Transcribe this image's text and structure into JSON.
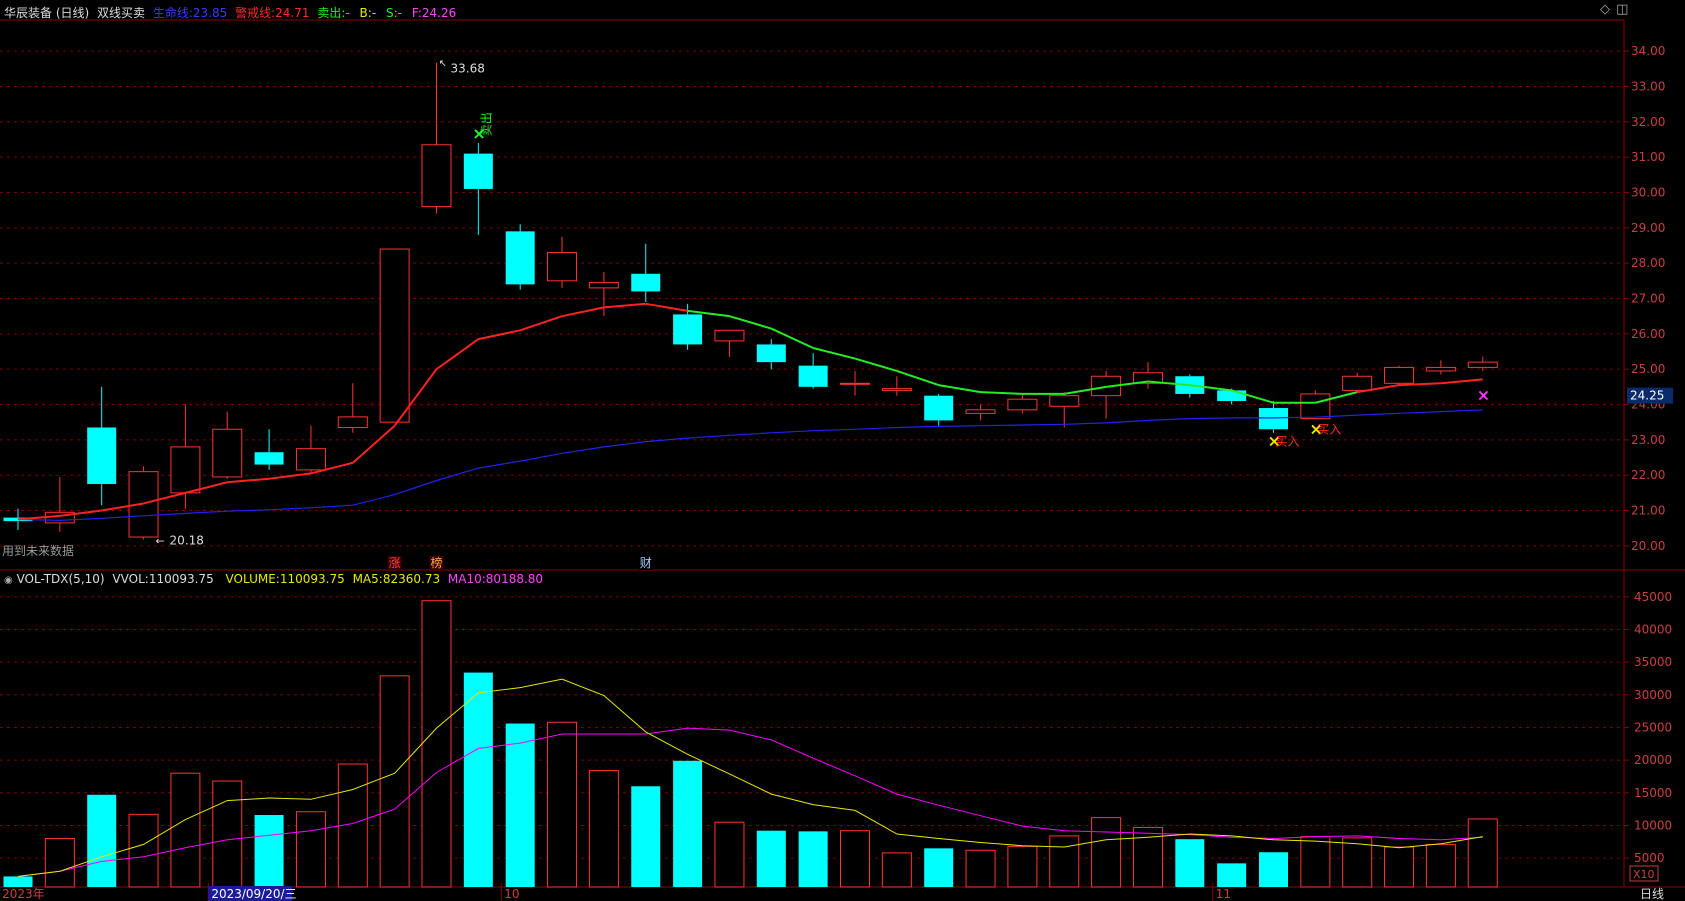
{
  "header": {
    "stock": "华辰装备 (日线)",
    "indicator": "双线买卖",
    "life_label": "生命线:",
    "life_value": "23.85",
    "warn_label": "警戒线:",
    "warn_value": "24.71",
    "sell_label": "卖出:",
    "sell_value": "-",
    "b_label": "B:",
    "b_value": "-",
    "s_label": "S:",
    "s_value": "-",
    "f_label": "F:",
    "f_value": "24.26"
  },
  "vol_header": {
    "name": "VOL-TDX(5,10)",
    "vvol_label": "VVOL:",
    "vvol_value": "110093.75",
    "volume_label": "VOLUME:",
    "volume_value": "110093.75",
    "ma5_label": "MA5:",
    "ma5_value": "82360.73",
    "ma10_label": "MA10:",
    "ma10_value": "80188.80"
  },
  "notes": {
    "future_data": "用到未来数据",
    "high_label": "33.68",
    "low_label": "20.18",
    "current_price": "24.25",
    "vol_multiplier": "X10",
    "period": "日线",
    "sell_signal": "卖出",
    "buy_signal": "买入",
    "markers": [
      "涨",
      "榜",
      "财"
    ]
  },
  "x_axis_labels": [
    {
      "label": "2023年",
      "index": 0
    },
    {
      "label": "2023/09/20/三",
      "index": 5
    },
    {
      "label": "10",
      "index": 12
    },
    {
      "label": "11",
      "index": 29
    }
  ],
  "colors": {
    "up": "#ff3232",
    "down": "#00ffff",
    "life_line": "#2222ee",
    "warn_up": "#ff2222",
    "warn_down": "#22ee22",
    "ma5": "#e8e800",
    "ma10": "#ff00ff",
    "grid": "#7a0000",
    "axis_text": "#c84040"
  },
  "chart_data": [
    {
      "type": "candlestick",
      "ylim": [
        19.6,
        34.4
      ],
      "yticks": [
        20,
        21,
        22,
        23,
        24,
        25,
        26,
        27,
        28,
        29,
        30,
        31,
        32,
        33,
        34
      ],
      "candles": [
        {
          "o": 20.8,
          "h": 21.05,
          "l": 20.45,
          "c": 20.7
        },
        {
          "o": 20.65,
          "h": 21.95,
          "l": 20.4,
          "c": 20.95
        },
        {
          "o": 23.35,
          "h": 24.5,
          "l": 21.15,
          "c": 21.75
        },
        {
          "o": 20.25,
          "h": 22.25,
          "l": 20.18,
          "c": 22.1
        },
        {
          "o": 21.5,
          "h": 24.0,
          "l": 21.05,
          "c": 22.8
        },
        {
          "o": 21.95,
          "h": 23.8,
          "l": 21.9,
          "c": 23.3
        },
        {
          "o": 22.65,
          "h": 23.3,
          "l": 22.15,
          "c": 22.3
        },
        {
          "o": 22.15,
          "h": 23.4,
          "l": 22.05,
          "c": 22.75
        },
        {
          "o": 23.35,
          "h": 24.6,
          "l": 23.2,
          "c": 23.65
        },
        {
          "o": 23.5,
          "h": 28.4,
          "l": 23.5,
          "c": 28.4
        },
        {
          "o": 29.6,
          "h": 33.68,
          "l": 29.4,
          "c": 31.35
        },
        {
          "o": 31.1,
          "h": 31.4,
          "l": 28.8,
          "c": 30.1
        },
        {
          "o": 28.9,
          "h": 29.1,
          "l": 27.25,
          "c": 27.4
        },
        {
          "o": 27.5,
          "h": 28.75,
          "l": 27.3,
          "c": 28.3
        },
        {
          "o": 27.3,
          "h": 27.75,
          "l": 26.5,
          "c": 27.45
        },
        {
          "o": 27.7,
          "h": 28.55,
          "l": 26.9,
          "c": 27.2
        },
        {
          "o": 26.55,
          "h": 26.85,
          "l": 25.55,
          "c": 25.7
        },
        {
          "o": 25.8,
          "h": 26.1,
          "l": 25.35,
          "c": 26.1
        },
        {
          "o": 25.7,
          "h": 25.85,
          "l": 25.0,
          "c": 25.2
        },
        {
          "o": 25.1,
          "h": 25.45,
          "l": 24.45,
          "c": 24.5
        },
        {
          "o": 24.6,
          "h": 24.95,
          "l": 24.25,
          "c": 24.6
        },
        {
          "o": 24.4,
          "h": 24.8,
          "l": 24.25,
          "c": 24.45
        },
        {
          "o": 24.25,
          "h": 24.3,
          "l": 23.4,
          "c": 23.55
        },
        {
          "o": 23.75,
          "h": 24.0,
          "l": 23.55,
          "c": 23.85
        },
        {
          "o": 23.85,
          "h": 24.3,
          "l": 23.75,
          "c": 24.15
        },
        {
          "o": 23.95,
          "h": 24.35,
          "l": 23.35,
          "c": 24.25
        },
        {
          "o": 24.25,
          "h": 24.95,
          "l": 23.6,
          "c": 24.8
        },
        {
          "o": 24.6,
          "h": 25.2,
          "l": 24.45,
          "c": 24.9
        },
        {
          "o": 24.8,
          "h": 24.85,
          "l": 24.2,
          "c": 24.3
        },
        {
          "o": 24.4,
          "h": 24.45,
          "l": 24.0,
          "c": 24.1
        },
        {
          "o": 23.9,
          "h": 24.1,
          "l": 23.2,
          "c": 23.3
        },
        {
          "o": 23.6,
          "h": 24.4,
          "l": 23.6,
          "c": 24.3
        },
        {
          "o": 24.4,
          "h": 24.9,
          "l": 24.35,
          "c": 24.8
        },
        {
          "o": 24.6,
          "h": 25.1,
          "l": 24.55,
          "c": 25.05
        },
        {
          "o": 24.95,
          "h": 25.25,
          "l": 24.85,
          "c": 25.05
        },
        {
          "o": 25.05,
          "h": 25.35,
          "l": 24.95,
          "c": 25.2
        }
      ],
      "warn_line": [
        20.75,
        20.85,
        21.0,
        21.2,
        21.5,
        21.8,
        21.9,
        22.05,
        22.35,
        23.4,
        25.0,
        25.85,
        26.1,
        26.5,
        26.75,
        26.85,
        26.65,
        26.5,
        26.15,
        25.6,
        25.3,
        24.95,
        24.55,
        24.35,
        24.3,
        24.3,
        24.5,
        24.65,
        24.55,
        24.4,
        24.05,
        24.05,
        24.35,
        24.55,
        24.6,
        24.71
      ],
      "warn_line_trend": [
        "up",
        "up",
        "up",
        "up",
        "up",
        "up",
        "up",
        "up",
        "up",
        "up",
        "up",
        "up",
        "up",
        "up",
        "up",
        "up",
        "up",
        "down",
        "down",
        "down",
        "down",
        "down",
        "down",
        "down",
        "down",
        "down",
        "down",
        "down",
        "down",
        "down",
        "down",
        "down",
        "down",
        "up",
        "up",
        "up"
      ],
      "life_line": [
        20.75,
        20.72,
        20.78,
        20.85,
        20.92,
        20.98,
        21.02,
        21.08,
        21.15,
        21.45,
        21.85,
        22.2,
        22.4,
        22.62,
        22.8,
        22.95,
        23.05,
        23.13,
        23.2,
        23.26,
        23.3,
        23.35,
        23.38,
        23.4,
        23.42,
        23.44,
        23.48,
        23.55,
        23.6,
        23.62,
        23.62,
        23.64,
        23.7,
        23.75,
        23.8,
        23.85
      ],
      "signals": [
        {
          "index": 11,
          "type": "sell",
          "price": 31.65
        },
        {
          "index": 30,
          "type": "buy",
          "price": 22.95
        },
        {
          "index": 31,
          "type": "buy",
          "price": 23.3
        },
        {
          "index": 35,
          "type": "f",
          "price": 24.26
        }
      ]
    },
    {
      "type": "bar",
      "unit_multiplier": "X10",
      "ylim": [
        1500,
        46500
      ],
      "yticks": [
        5000,
        10000,
        15000,
        20000,
        25000,
        30000,
        35000,
        40000,
        45000
      ],
      "volume": [
        2200,
        8000,
        14700,
        11700,
        18000,
        16800,
        11600,
        12100,
        19400,
        32900,
        44400,
        33400,
        25600,
        25800,
        18400,
        16000,
        19900,
        10500,
        9200,
        9100,
        9200,
        5800,
        6500,
        6200,
        6800,
        8400,
        11200,
        9700,
        7900,
        4200,
        5900,
        8300,
        8100,
        6700,
        7100,
        11000
      ],
      "ma5": [
        2200,
        3000,
        5200,
        7100,
        10900,
        13800,
        14200,
        14000,
        15500,
        18000,
        24900,
        30300,
        31100,
        32400,
        29900,
        24300,
        20900,
        17900,
        14800,
        13200,
        12300,
        8700,
        8000,
        7400,
        6900,
        6700,
        7800,
        8200,
        8700,
        8400,
        7800,
        7600,
        7200,
        6600,
        7200,
        8300
      ],
      "ma10": [
        2200,
        3000,
        4500,
        5200,
        6600,
        7800,
        8500,
        9200,
        10300,
        12500,
        18100,
        21800,
        22600,
        24000,
        24000,
        24000,
        24900,
        24600,
        23100,
        20300,
        17600,
        14800,
        13100,
        11500,
        9900,
        9200,
        9000,
        8800,
        8600,
        8200,
        8000,
        8300,
        8400,
        8000,
        7800,
        8200
      ]
    }
  ]
}
